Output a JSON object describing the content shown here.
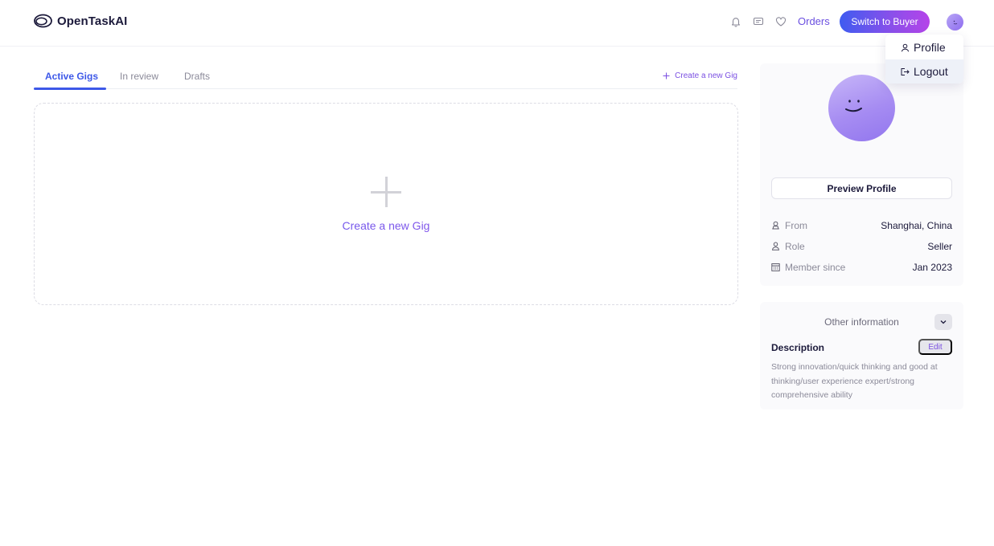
{
  "header": {
    "logo_text": "OpenTaskAI",
    "orders_label": "Orders",
    "switch_label": "Switch to Buyer"
  },
  "user_menu": {
    "profile_label": "Profile",
    "logout_label": "Logout"
  },
  "tabs": [
    {
      "label": "Active Gigs"
    },
    {
      "label": "In review"
    },
    {
      "label": "Drafts"
    }
  ],
  "create_link_label": "Create a new Gig",
  "create_box_label": "Create a new Gig",
  "profile": {
    "preview_label": "Preview Profile",
    "info": [
      {
        "icon": "location-icon",
        "label": "From",
        "value": "Shanghai, China"
      },
      {
        "icon": "user-icon",
        "label": "Role",
        "value": "Seller"
      },
      {
        "icon": "calendar-icon",
        "label": "Member since",
        "value": "Jan 2023"
      }
    ]
  },
  "other": {
    "title": "Other information",
    "description_title": "Description",
    "edit_label": "Edit",
    "description_text": "Strong innovation/quick thinking and good at thinking/user experience expert/strong comprehensive ability"
  },
  "colors": {
    "accent_blue": "#3d58e8",
    "accent_purple": "#7a4fe2",
    "gradient_start": "#3f5cf0",
    "gradient_end": "#b544e9"
  }
}
